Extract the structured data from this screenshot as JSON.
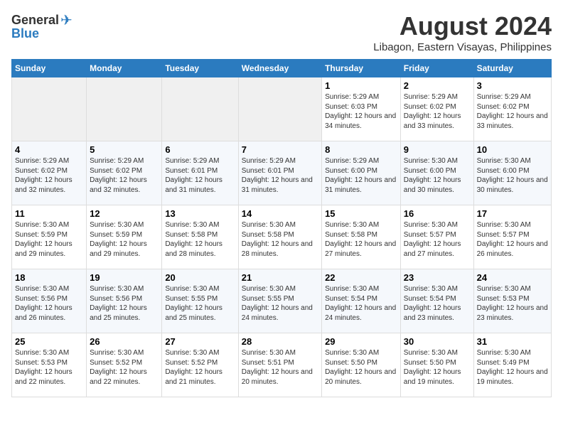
{
  "logo": {
    "general": "General",
    "blue": "Blue"
  },
  "title": "August 2024",
  "subtitle": "Libagon, Eastern Visayas, Philippines",
  "days_of_week": [
    "Sunday",
    "Monday",
    "Tuesday",
    "Wednesday",
    "Thursday",
    "Friday",
    "Saturday"
  ],
  "weeks": [
    {
      "days": [
        {
          "num": "",
          "empty": true
        },
        {
          "num": "",
          "empty": true
        },
        {
          "num": "",
          "empty": true
        },
        {
          "num": "",
          "empty": true
        },
        {
          "num": "1",
          "sunrise": "Sunrise: 5:29 AM",
          "sunset": "Sunset: 6:03 PM",
          "daylight": "Daylight: 12 hours and 34 minutes."
        },
        {
          "num": "2",
          "sunrise": "Sunrise: 5:29 AM",
          "sunset": "Sunset: 6:02 PM",
          "daylight": "Daylight: 12 hours and 33 minutes."
        },
        {
          "num": "3",
          "sunrise": "Sunrise: 5:29 AM",
          "sunset": "Sunset: 6:02 PM",
          "daylight": "Daylight: 12 hours and 33 minutes."
        }
      ]
    },
    {
      "days": [
        {
          "num": "4",
          "sunrise": "Sunrise: 5:29 AM",
          "sunset": "Sunset: 6:02 PM",
          "daylight": "Daylight: 12 hours and 32 minutes."
        },
        {
          "num": "5",
          "sunrise": "Sunrise: 5:29 AM",
          "sunset": "Sunset: 6:02 PM",
          "daylight": "Daylight: 12 hours and 32 minutes."
        },
        {
          "num": "6",
          "sunrise": "Sunrise: 5:29 AM",
          "sunset": "Sunset: 6:01 PM",
          "daylight": "Daylight: 12 hours and 31 minutes."
        },
        {
          "num": "7",
          "sunrise": "Sunrise: 5:29 AM",
          "sunset": "Sunset: 6:01 PM",
          "daylight": "Daylight: 12 hours and 31 minutes."
        },
        {
          "num": "8",
          "sunrise": "Sunrise: 5:29 AM",
          "sunset": "Sunset: 6:00 PM",
          "daylight": "Daylight: 12 hours and 31 minutes."
        },
        {
          "num": "9",
          "sunrise": "Sunrise: 5:30 AM",
          "sunset": "Sunset: 6:00 PM",
          "daylight": "Daylight: 12 hours and 30 minutes."
        },
        {
          "num": "10",
          "sunrise": "Sunrise: 5:30 AM",
          "sunset": "Sunset: 6:00 PM",
          "daylight": "Daylight: 12 hours and 30 minutes."
        }
      ]
    },
    {
      "days": [
        {
          "num": "11",
          "sunrise": "Sunrise: 5:30 AM",
          "sunset": "Sunset: 5:59 PM",
          "daylight": "Daylight: 12 hours and 29 minutes."
        },
        {
          "num": "12",
          "sunrise": "Sunrise: 5:30 AM",
          "sunset": "Sunset: 5:59 PM",
          "daylight": "Daylight: 12 hours and 29 minutes."
        },
        {
          "num": "13",
          "sunrise": "Sunrise: 5:30 AM",
          "sunset": "Sunset: 5:58 PM",
          "daylight": "Daylight: 12 hours and 28 minutes."
        },
        {
          "num": "14",
          "sunrise": "Sunrise: 5:30 AM",
          "sunset": "Sunset: 5:58 PM",
          "daylight": "Daylight: 12 hours and 28 minutes."
        },
        {
          "num": "15",
          "sunrise": "Sunrise: 5:30 AM",
          "sunset": "Sunset: 5:58 PM",
          "daylight": "Daylight: 12 hours and 27 minutes."
        },
        {
          "num": "16",
          "sunrise": "Sunrise: 5:30 AM",
          "sunset": "Sunset: 5:57 PM",
          "daylight": "Daylight: 12 hours and 27 minutes."
        },
        {
          "num": "17",
          "sunrise": "Sunrise: 5:30 AM",
          "sunset": "Sunset: 5:57 PM",
          "daylight": "Daylight: 12 hours and 26 minutes."
        }
      ]
    },
    {
      "days": [
        {
          "num": "18",
          "sunrise": "Sunrise: 5:30 AM",
          "sunset": "Sunset: 5:56 PM",
          "daylight": "Daylight: 12 hours and 26 minutes."
        },
        {
          "num": "19",
          "sunrise": "Sunrise: 5:30 AM",
          "sunset": "Sunset: 5:56 PM",
          "daylight": "Daylight: 12 hours and 25 minutes."
        },
        {
          "num": "20",
          "sunrise": "Sunrise: 5:30 AM",
          "sunset": "Sunset: 5:55 PM",
          "daylight": "Daylight: 12 hours and 25 minutes."
        },
        {
          "num": "21",
          "sunrise": "Sunrise: 5:30 AM",
          "sunset": "Sunset: 5:55 PM",
          "daylight": "Daylight: 12 hours and 24 minutes."
        },
        {
          "num": "22",
          "sunrise": "Sunrise: 5:30 AM",
          "sunset": "Sunset: 5:54 PM",
          "daylight": "Daylight: 12 hours and 24 minutes."
        },
        {
          "num": "23",
          "sunrise": "Sunrise: 5:30 AM",
          "sunset": "Sunset: 5:54 PM",
          "daylight": "Daylight: 12 hours and 23 minutes."
        },
        {
          "num": "24",
          "sunrise": "Sunrise: 5:30 AM",
          "sunset": "Sunset: 5:53 PM",
          "daylight": "Daylight: 12 hours and 23 minutes."
        }
      ]
    },
    {
      "days": [
        {
          "num": "25",
          "sunrise": "Sunrise: 5:30 AM",
          "sunset": "Sunset: 5:53 PM",
          "daylight": "Daylight: 12 hours and 22 minutes."
        },
        {
          "num": "26",
          "sunrise": "Sunrise: 5:30 AM",
          "sunset": "Sunset: 5:52 PM",
          "daylight": "Daylight: 12 hours and 22 minutes."
        },
        {
          "num": "27",
          "sunrise": "Sunrise: 5:30 AM",
          "sunset": "Sunset: 5:52 PM",
          "daylight": "Daylight: 12 hours and 21 minutes."
        },
        {
          "num": "28",
          "sunrise": "Sunrise: 5:30 AM",
          "sunset": "Sunset: 5:51 PM",
          "daylight": "Daylight: 12 hours and 20 minutes."
        },
        {
          "num": "29",
          "sunrise": "Sunrise: 5:30 AM",
          "sunset": "Sunset: 5:50 PM",
          "daylight": "Daylight: 12 hours and 20 minutes."
        },
        {
          "num": "30",
          "sunrise": "Sunrise: 5:30 AM",
          "sunset": "Sunset: 5:50 PM",
          "daylight": "Daylight: 12 hours and 19 minutes."
        },
        {
          "num": "31",
          "sunrise": "Sunrise: 5:30 AM",
          "sunset": "Sunset: 5:49 PM",
          "daylight": "Daylight: 12 hours and 19 minutes."
        }
      ]
    }
  ]
}
